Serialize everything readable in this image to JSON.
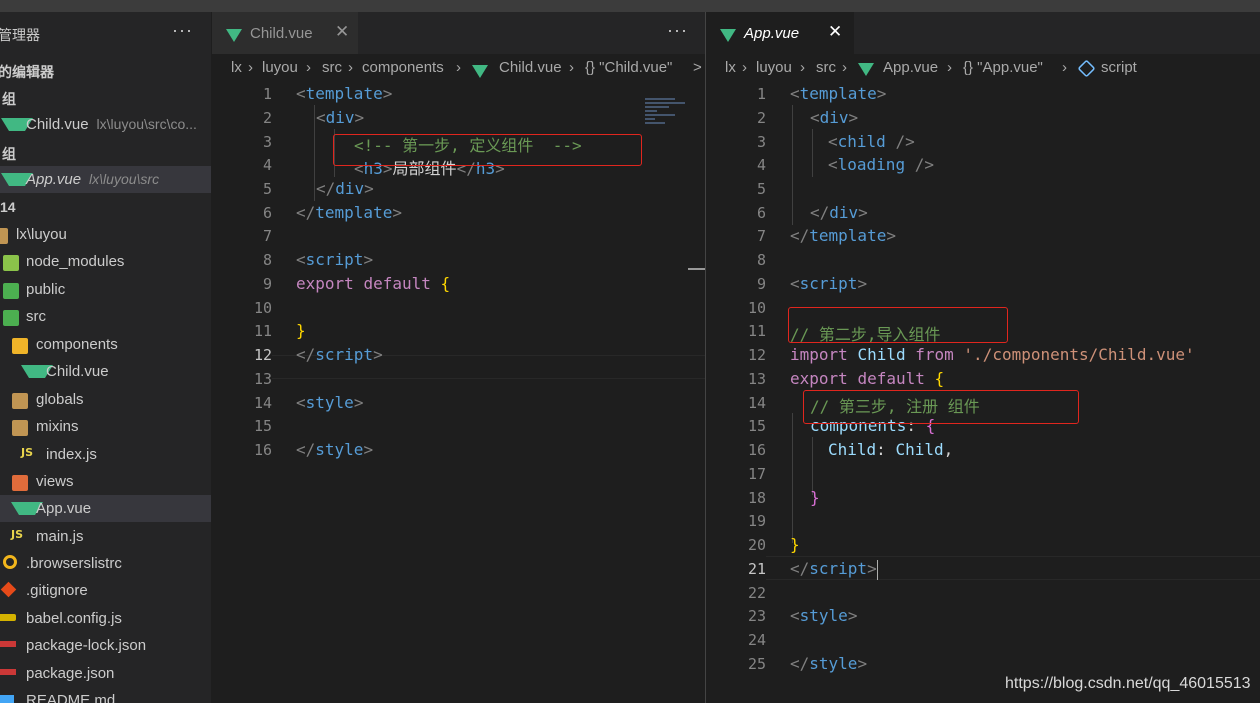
{
  "sidebar": {
    "title": "管理器",
    "more": "···",
    "open_editors": "的编辑器",
    "group1": "组",
    "group2": "组",
    "open1": {
      "name": "Child.vue",
      "path": "lx\\luyou\\src\\co..."
    },
    "open2": {
      "name": "App.vue",
      "path": "lx\\luyou\\src"
    },
    "workspace": "14",
    "tree": [
      {
        "label": "lx\\luyou"
      },
      {
        "label": "node_modules"
      },
      {
        "label": "public"
      },
      {
        "label": "src"
      },
      {
        "label": "components"
      },
      {
        "label": "Child.vue"
      },
      {
        "label": "globals"
      },
      {
        "label": "mixins"
      },
      {
        "label": "index.js"
      },
      {
        "label": "views"
      },
      {
        "label": "App.vue"
      },
      {
        "label": "main.js"
      },
      {
        "label": ".browserslistrc"
      },
      {
        "label": ".gitignore"
      },
      {
        "label": "babel.config.js"
      },
      {
        "label": "package-lock.json"
      },
      {
        "label": "package.json"
      },
      {
        "label": "README.md"
      }
    ]
  },
  "left_editor": {
    "tab": {
      "name": "Child.vue",
      "close": "✕"
    },
    "more": "···",
    "breadcrumb": [
      "lx",
      "luyou",
      "src",
      "components",
      "Child.vue",
      "{} \"Child.vue\"",
      ">"
    ],
    "line_numbers": [
      "1",
      "2",
      "3",
      "4",
      "5",
      "6",
      "7",
      "8",
      "9",
      "10",
      "11",
      "12",
      "13",
      "14",
      "15",
      "16"
    ],
    "current_line": "12",
    "comment": "<!-- 第一步, 定义组件  -->",
    "h3_text": "局部组件"
  },
  "right_editor": {
    "tab": {
      "name": "App.vue",
      "close": "✕"
    },
    "breadcrumb": [
      "lx",
      "luyou",
      "src",
      "App.vue",
      "{} \"App.vue\"",
      "script"
    ],
    "line_numbers": [
      "1",
      "2",
      "3",
      "4",
      "5",
      "6",
      "7",
      "8",
      "9",
      "10",
      "11",
      "12",
      "13",
      "14",
      "15",
      "16",
      "17",
      "18",
      "19",
      "20",
      "21",
      "22",
      "23",
      "24",
      "25"
    ],
    "current_line": "21",
    "comment_step2": "// 第二步,导入组件",
    "comment_step3": "// 第三步, 注册 组件",
    "import_path": "'./components/Child.vue'"
  },
  "watermark": "https://blog.csdn.net/qq_46015513",
  "colors": {
    "vue": "#41b883",
    "annotation_box": "#e0261e",
    "keyword": "#c586c0",
    "tag": "#569cd6"
  }
}
